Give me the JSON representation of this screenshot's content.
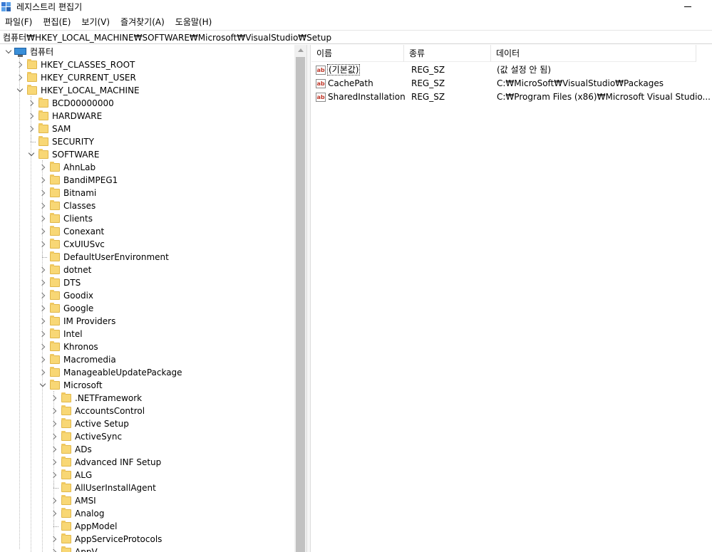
{
  "window": {
    "title": "레지스트리 편집기",
    "app_icon": "registry-editor-icon"
  },
  "menu": [
    "파일(F)",
    "편집(E)",
    "보기(V)",
    "즐겨찾기(A)",
    "도움말(H)"
  ],
  "address": "컴퓨터₩HKEY_LOCAL_MACHINE₩SOFTWARE₩Microsoft₩VisualStudio₩Setup",
  "tree": {
    "root": "컴퓨터",
    "hives": [
      "HKEY_CLASSES_ROOT",
      "HKEY_CURRENT_USER",
      "HKEY_LOCAL_MACHINE"
    ],
    "hklm_children": [
      "BCD00000000",
      "HARDWARE",
      "SAM",
      "SECURITY",
      "SOFTWARE"
    ],
    "software_children": [
      "AhnLab",
      "BandiMPEG1",
      "Bitnami",
      "Classes",
      "Clients",
      "Conexant",
      "CxUIUSvc",
      "DefaultUserEnvironment",
      "dotnet",
      "DTS",
      "Goodix",
      "Google",
      "IM Providers",
      "Intel",
      "Khronos",
      "Macromedia",
      "ManageableUpdatePackage",
      "Microsoft"
    ],
    "microsoft_children": [
      ".NETFramework",
      "AccountsControl",
      "Active Setup",
      "ActiveSync",
      "ADs",
      "Advanced INF Setup",
      "ALG",
      "AllUserInstallAgent",
      "AMSI",
      "Analog",
      "AppModel",
      "AppServiceProtocols",
      "AppV"
    ]
  },
  "values_header": {
    "name": "이름",
    "type": "종류",
    "data": "데이터"
  },
  "values": [
    {
      "name": "(기본값)",
      "type": "REG_SZ",
      "data": "(값 설정 안 됨)"
    },
    {
      "name": "CachePath",
      "type": "REG_SZ",
      "data": "C:₩MicroSoft₩VisualStudio₩Packages"
    },
    {
      "name": "SharedInstallation...",
      "type": "REG_SZ",
      "data": "C:₩Program Files (x86)₩Microsoft Visual Studio..."
    }
  ],
  "colors": {
    "folder": "#f8d775",
    "scroll_thumb": "#c1c1c1"
  }
}
